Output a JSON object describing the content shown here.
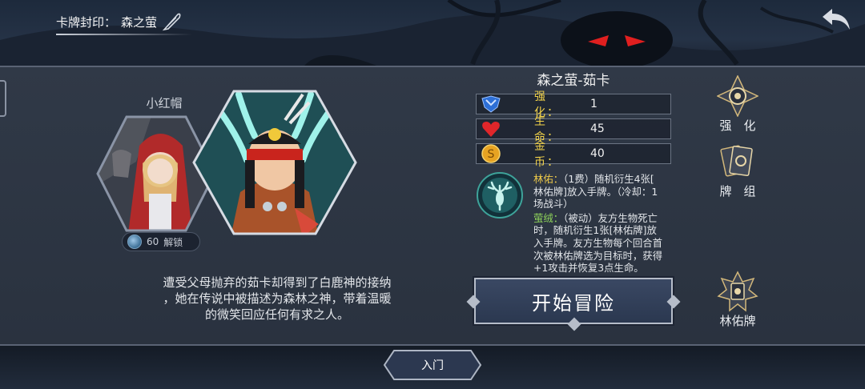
{
  "header": {
    "seal_label": "卡牌封印：",
    "seal_value": "森之萤"
  },
  "character": {
    "name": "小红帽",
    "unlock_cost": "60",
    "unlock_label": "解锁"
  },
  "story": {
    "line1": "遭受父母抛弃的茹卡却得到了白鹿神的接纳",
    "line2": "，她在传说中被描述为森林之神，带着温暖",
    "line3": "的微笑回应任何有求之人。"
  },
  "card": {
    "title": "森之萤-茹卡",
    "stats": [
      {
        "label": "强　化：",
        "value": "1",
        "icon": "blue-shield-icon"
      },
      {
        "label": "生　命：",
        "value": "45",
        "icon": "red-heart-icon"
      },
      {
        "label": "金　币：",
        "value": "40",
        "icon": "gold-coin-icon"
      }
    ],
    "skills": [
      {
        "name": "林佑：",
        "text1": "（1费）随机衍生4张[",
        "text2": "林佑牌]放入手牌。（冷却：1",
        "text3": "场战斗）"
      },
      {
        "name": "萤绒：",
        "text1": "（被动）友方生物死亡",
        "text2": "时，随机衍生1张[林佑牌]放",
        "text3": "入手牌。友方生物每个回合首",
        "text4": "次被林佑牌选为目标时，获得",
        "text5": "+1攻击并恢复3点生命。"
      }
    ]
  },
  "start_button": "开始冒险",
  "menu": [
    {
      "label": "强　化",
      "icon": "compass-emblem-icon"
    },
    {
      "label": "牌　组",
      "icon": "card-deck-icon"
    },
    {
      "label": "林佑牌",
      "icon": "gear-emblem-icon"
    }
  ],
  "bottom_tab": "入门",
  "colors": {
    "stat_label": "#f3d34a",
    "skill_name_1": "#f0cb4a",
    "skill_name_2": "#8ed35a",
    "panel": "#2f3846"
  }
}
